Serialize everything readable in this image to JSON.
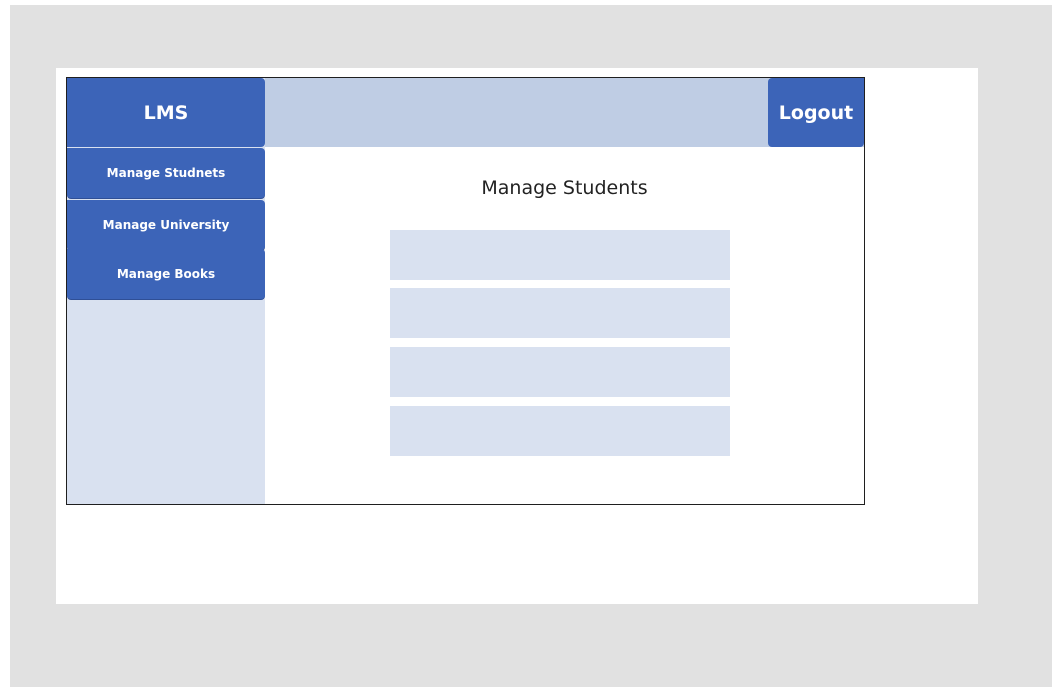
{
  "app": {
    "brand": "LMS",
    "logout_label": "Logout"
  },
  "sidebar": {
    "items": [
      {
        "label": "Manage Studnets"
      },
      {
        "label": "Manage University"
      },
      {
        "label": "Manage Books"
      }
    ]
  },
  "main": {
    "title": "Manage Students",
    "fields": [
      {
        "value": "",
        "placeholder": ""
      },
      {
        "value": "",
        "placeholder": ""
      },
      {
        "value": "",
        "placeholder": ""
      },
      {
        "value": "",
        "placeholder": ""
      }
    ]
  },
  "colors": {
    "primary": "#3c64b8",
    "header_bg": "#bfcde4",
    "sidebar_bg": "#d9e1f0",
    "field_bg": "#d9e1f0",
    "backdrop": "#e1e1e1"
  }
}
